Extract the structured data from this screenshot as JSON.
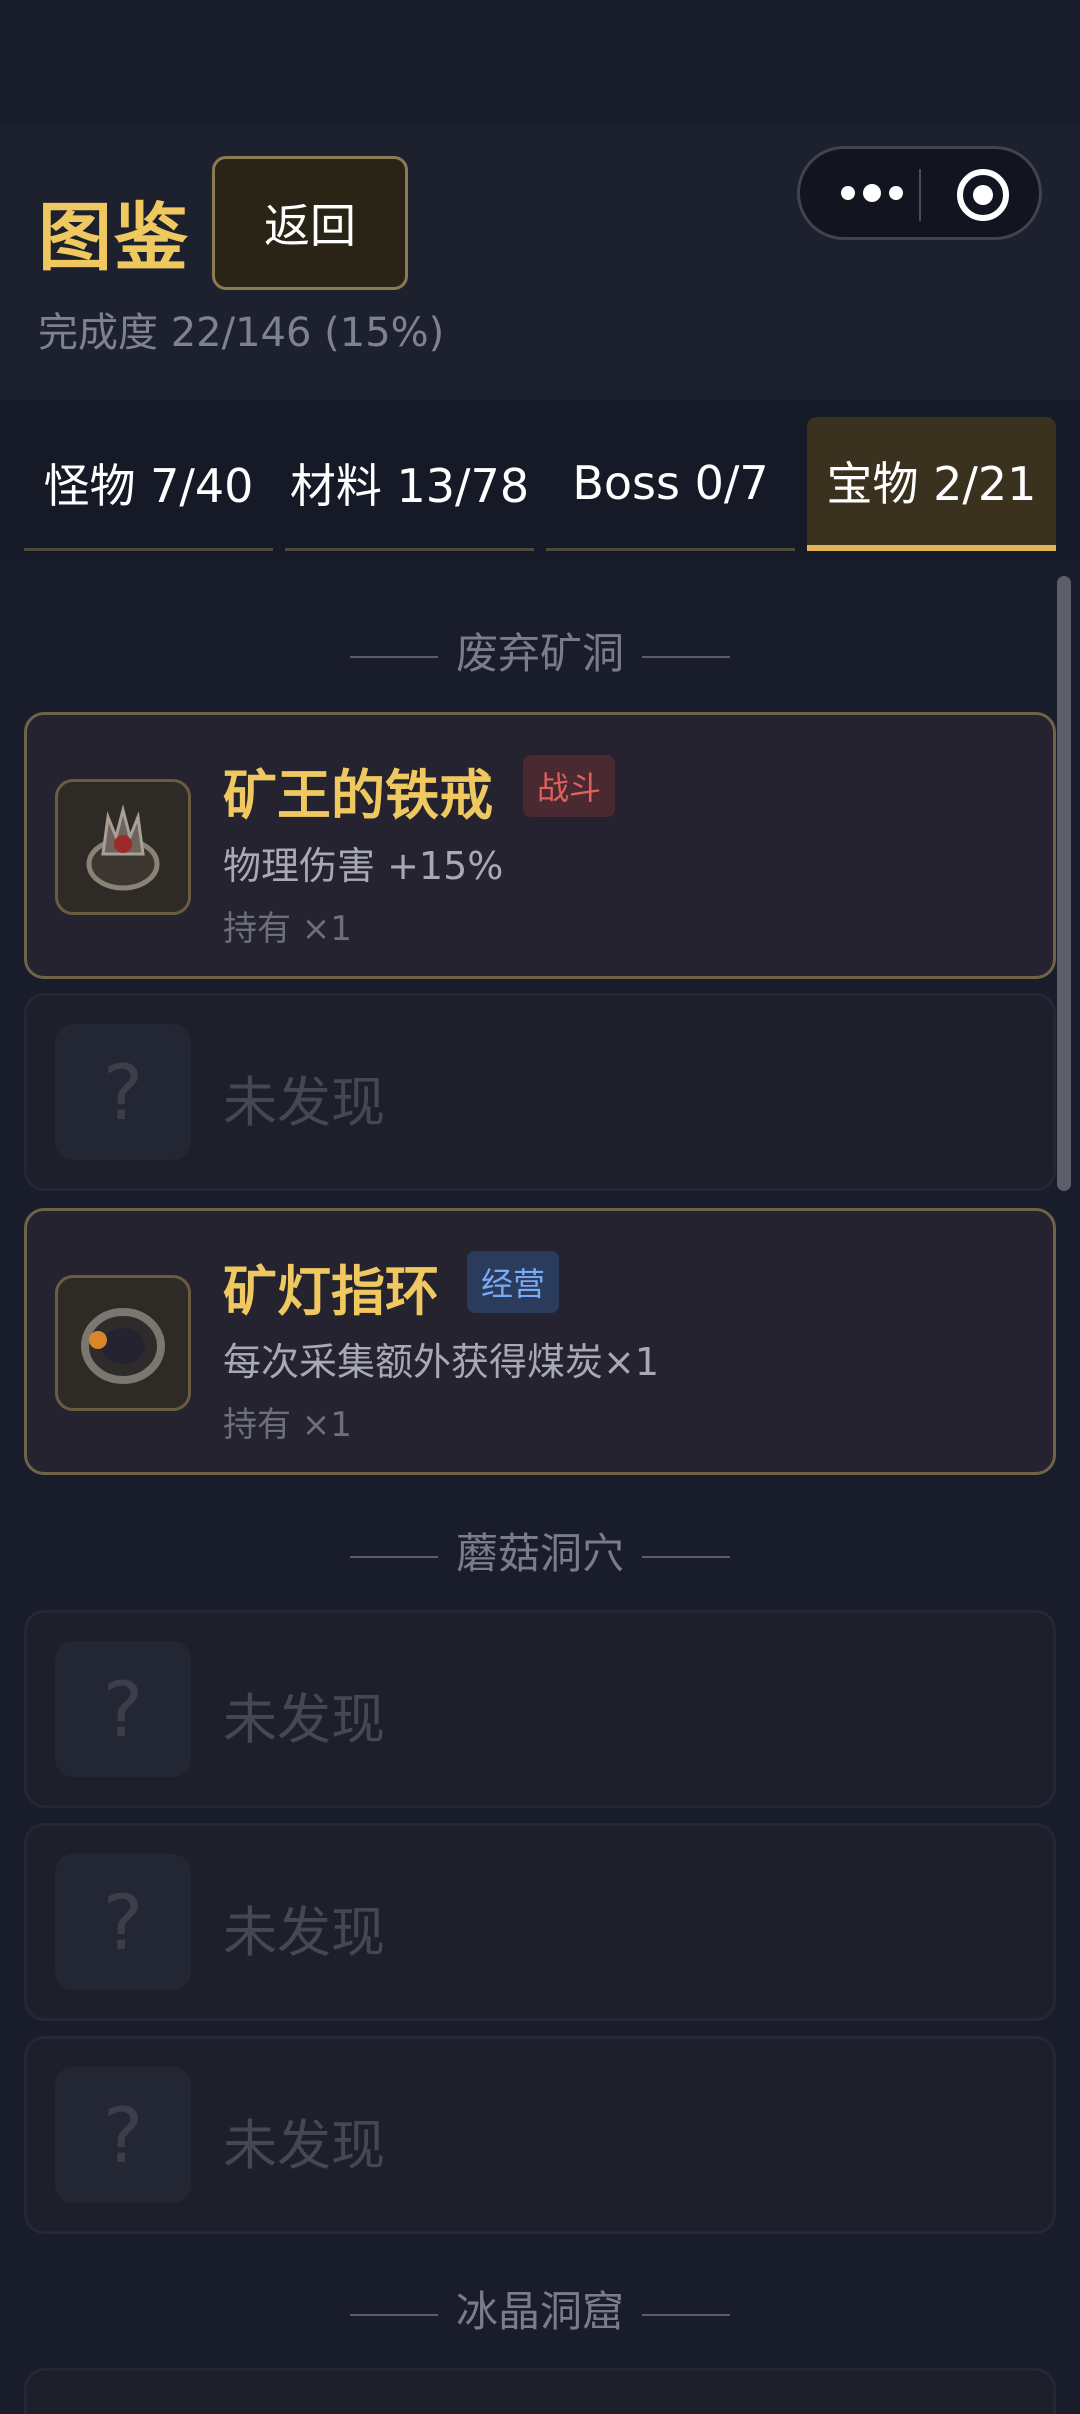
{
  "header": {
    "title": "图鉴",
    "back_label": "返回",
    "progress": "完成度 22/146 (15%)"
  },
  "tabs": [
    {
      "label": "怪物 7/40",
      "active": false
    },
    {
      "label": "材料 13/78",
      "active": false
    },
    {
      "label": "Boss 0/7",
      "active": false
    },
    {
      "label": "宝物 2/21",
      "active": true
    }
  ],
  "colors": {
    "accent_gold": "#f0c860",
    "tab_active_underline": "#e3b557",
    "tag_battle": "#e0605e",
    "tag_business": "#78aaf5"
  },
  "sections": [
    {
      "title": "废弃矿洞",
      "items": [
        {
          "name": "矿王的铁戒",
          "tag": "战斗",
          "desc": "物理伤害 +15%",
          "qty": "持有 ×1",
          "icon": "iron-ring-icon"
        },
        {
          "locked_label": "未发现",
          "icon": "question-mark-icon"
        },
        {
          "name": "矿灯指环",
          "tag": "经营",
          "desc": "每次采集额外获得煤炭×1",
          "qty": "持有 ×1",
          "icon": "lamp-ring-icon"
        }
      ]
    },
    {
      "title": "蘑菇洞穴",
      "items": [
        {
          "locked_label": "未发现",
          "icon": "question-mark-icon"
        },
        {
          "locked_label": "未发现",
          "icon": "question-mark-icon"
        },
        {
          "locked_label": "未发现",
          "icon": "question-mark-icon"
        }
      ]
    },
    {
      "title": "冰晶洞窟",
      "items": []
    }
  ],
  "icons": {
    "more": "more-dots-icon",
    "close": "target-circle-icon",
    "locked": "?"
  }
}
